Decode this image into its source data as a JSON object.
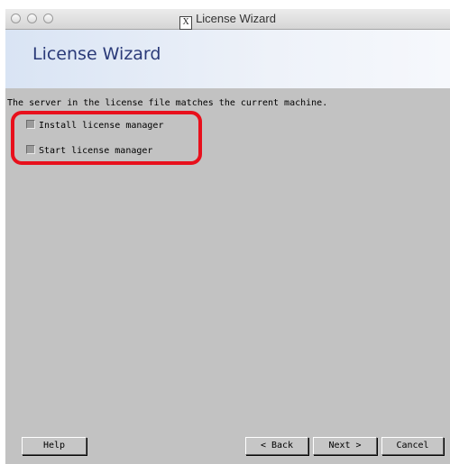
{
  "window": {
    "title": "License Wizard",
    "x_icon_glyph": "X"
  },
  "banner": {
    "title": "License Wizard"
  },
  "content": {
    "message": "The server in the license file matches the current machine.",
    "options": [
      {
        "label": "Install license manager",
        "checked": false,
        "enabled": false
      },
      {
        "label": "Start license manager",
        "checked": false,
        "enabled": false
      }
    ]
  },
  "buttons": {
    "help": "Help",
    "back": "< Back",
    "next": "Next >",
    "cancel": "Cancel"
  },
  "colors": {
    "dialog_background": "#c2c2c2",
    "banner_title": "#2a3a78",
    "highlight": "#e8101c"
  }
}
